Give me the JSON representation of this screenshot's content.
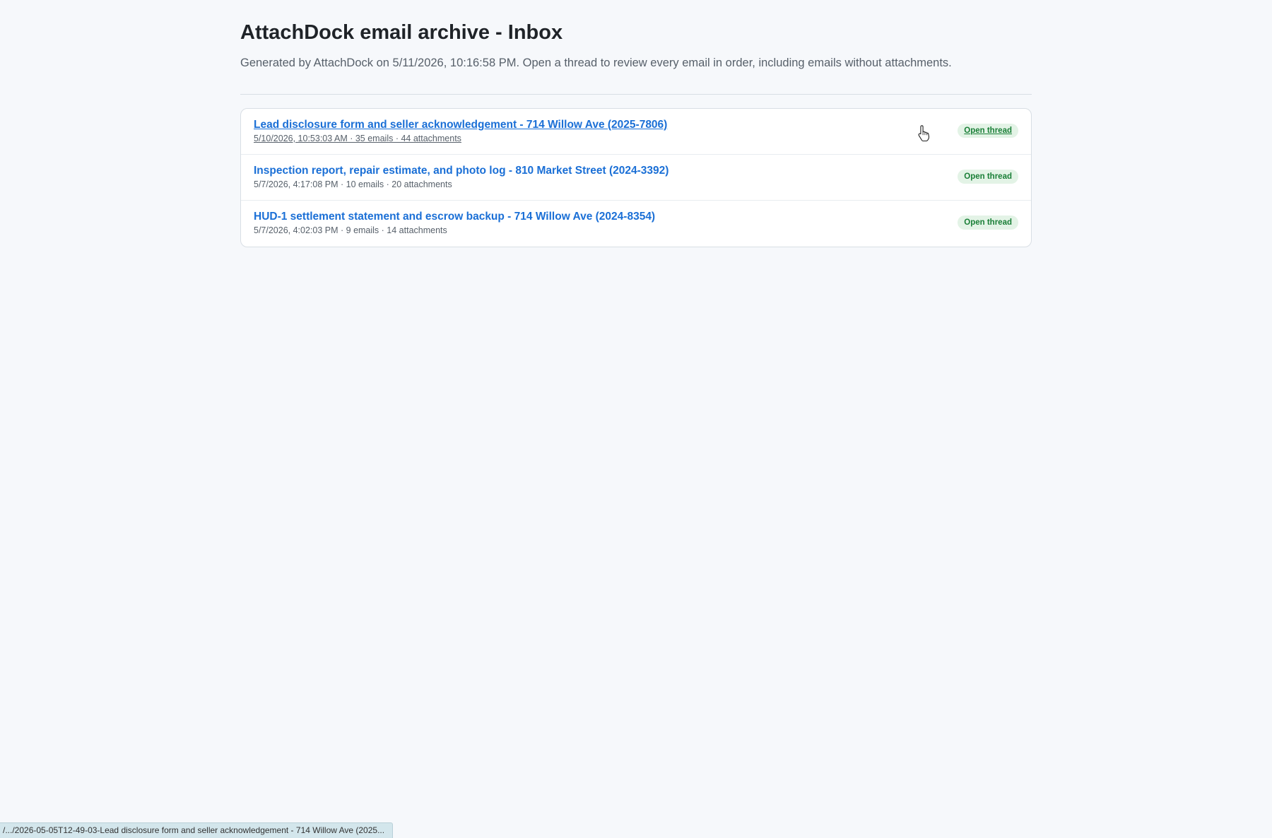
{
  "page": {
    "title": "AttachDock email archive - Inbox",
    "subtitle": "Generated by AttachDock on 5/11/2026, 10:16:58 PM. Open a thread to review every email in order, including emails without attachments."
  },
  "threads": [
    {
      "subject": "Lead disclosure form and seller acknowledgement - 714 Willow Ave (2025-7806)",
      "meta": "5/10/2026, 10:53:03 AM · 35 emails · 44 attachments",
      "action": "Open thread",
      "hovered": true
    },
    {
      "subject": "Inspection report, repair estimate, and photo log - 810 Market Street (2024-3392)",
      "meta": "5/7/2026, 4:17:08 PM · 10 emails · 20 attachments",
      "action": "Open thread",
      "hovered": false
    },
    {
      "subject": "HUD-1 settlement statement and escrow backup - 714 Willow Ave (2024-8354)",
      "meta": "5/7/2026, 4:02:03 PM · 9 emails · 14 attachments",
      "action": "Open thread",
      "hovered": false
    }
  ],
  "status_bar": {
    "url": "/.../2026-05-05T12-49-03-Lead disclosure form and seller acknowledgement - 714 Willow Ave (2025..."
  },
  "icons": {
    "cursor": "hand-pointer-icon"
  },
  "colors": {
    "link": "#1a6fd6",
    "badge_bg": "#e3f3e6",
    "badge_text": "#1a7f37",
    "page_bg": "#f6f8fb"
  }
}
